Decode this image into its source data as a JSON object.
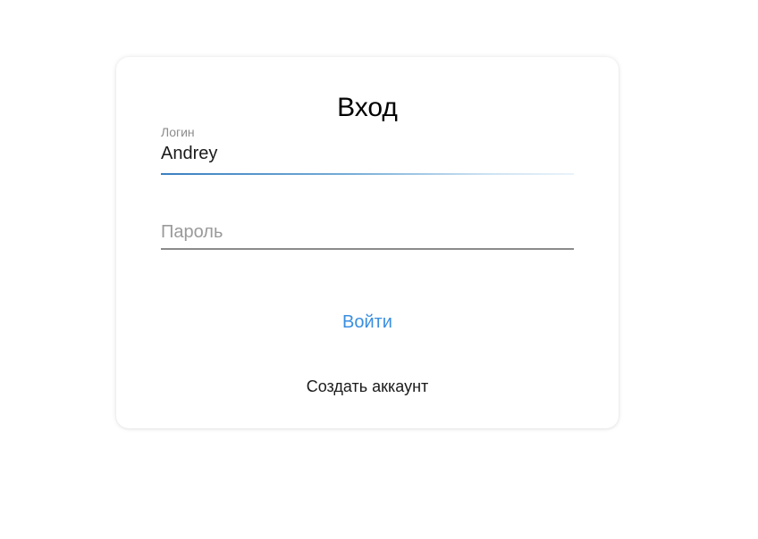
{
  "login_card": {
    "title": "Вход",
    "login_field": {
      "label": "Логин",
      "value": "Andrey"
    },
    "password_field": {
      "placeholder": "Пароль",
      "value": ""
    },
    "submit_label": "Войти",
    "create_account_label": "Создать аккаунт"
  },
  "colors": {
    "accent": "#3a8ee0",
    "focus_underline": "#3a7fc0",
    "underline": "#8a8a8a",
    "label": "#8d8d8d"
  }
}
